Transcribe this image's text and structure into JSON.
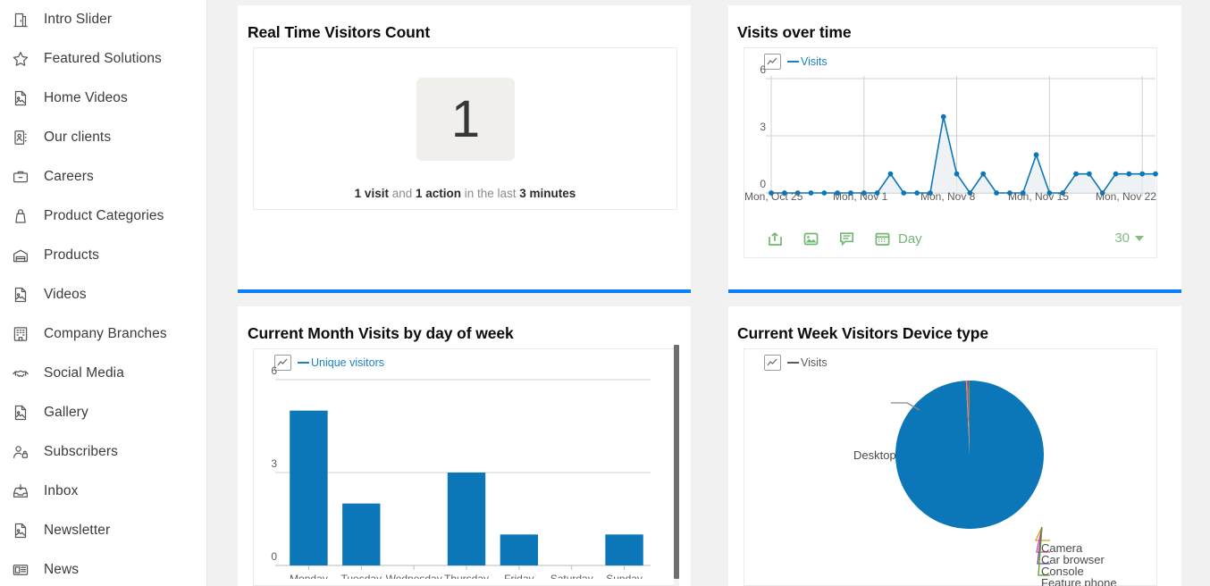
{
  "sidebar": {
    "items": [
      {
        "label": "Intro Slider",
        "icon": "door-icon"
      },
      {
        "label": "Featured Solutions",
        "icon": "star-icon"
      },
      {
        "label": "Home Videos",
        "icon": "document-image-icon"
      },
      {
        "label": "Our clients",
        "icon": "contact-card-icon"
      },
      {
        "label": "Careers",
        "icon": "briefcase-icon"
      },
      {
        "label": "Product Categories",
        "icon": "bag-icon"
      },
      {
        "label": "Products",
        "icon": "warehouse-icon"
      },
      {
        "label": "Videos",
        "icon": "document-image-icon"
      },
      {
        "label": "Company Branches",
        "icon": "office-building-icon"
      },
      {
        "label": "Social Media",
        "icon": "handshake-icon"
      },
      {
        "label": "Gallery",
        "icon": "document-image-icon"
      },
      {
        "label": "Subscribers",
        "icon": "user-lock-icon"
      },
      {
        "label": "Inbox",
        "icon": "inbox-icon"
      },
      {
        "label": "Newsletter",
        "icon": "document-image-icon"
      },
      {
        "label": "News",
        "icon": "newspaper-icon"
      }
    ]
  },
  "cards": {
    "realtime": {
      "title": "Real Time Visitors Count",
      "count": "1",
      "caption": {
        "visits": "1 visit",
        "and": " and ",
        "actions": "1 action",
        "inlast": " in the last ",
        "period": "3 minutes"
      }
    },
    "visits_over_time": {
      "title": "Visits over time",
      "toolbar": {
        "export_icon": "export-icon",
        "image_icon": "image-export-icon",
        "annotation_icon": "annotation-icon",
        "calendar_icon": "calendar-icon",
        "period_label": "Day",
        "rows_label": "30"
      }
    },
    "visits_by_day": {
      "title": "Current Month Visits by day of week"
    },
    "device_type": {
      "title": "Current Week Visitors Device type"
    }
  },
  "colors": {
    "accent_blue": "#0a7ff5",
    "series_blue": "#0b76b8",
    "legend_blue": "#1b7fc4",
    "toolbar_green": "#72b772",
    "page_bg": "#f1f1f1",
    "badge_bg": "#f0efec"
  },
  "chart_data": [
    {
      "id": "visits-over-time",
      "type": "line",
      "title": "Visits over time",
      "legend": [
        "Visits"
      ],
      "legend_position": "top-left",
      "ylabel": "",
      "xlabel": "",
      "ylim": [
        0,
        6
      ],
      "yticks": [
        0,
        3,
        6
      ],
      "grid": true,
      "xtick_labels": [
        "Mon, Oct 25",
        "Mon, Nov 1",
        "Mon, Nov 8",
        "Mon, Nov 15",
        "Mon, Nov 22"
      ],
      "x": [
        "Oct 25",
        "Oct 26",
        "Oct 27",
        "Oct 28",
        "Oct 29",
        "Oct 30",
        "Oct 31",
        "Nov 1",
        "Nov 2",
        "Nov 3",
        "Nov 4",
        "Nov 5",
        "Nov 6",
        "Nov 7",
        "Nov 8",
        "Nov 9",
        "Nov 10",
        "Nov 11",
        "Nov 12",
        "Nov 13",
        "Nov 14",
        "Nov 15",
        "Nov 16",
        "Nov 17",
        "Nov 18",
        "Nov 19",
        "Nov 20",
        "Nov 21",
        "Nov 22",
        "Nov 23"
      ],
      "series": [
        {
          "name": "Visits",
          "values": [
            0,
            0,
            0,
            0,
            0,
            0,
            0,
            0,
            0,
            1,
            0,
            0,
            0,
            4,
            1,
            0,
            1,
            0,
            0,
            0,
            2,
            0,
            0,
            1,
            1,
            0,
            1,
            1,
            1,
            1
          ]
        }
      ]
    },
    {
      "id": "visits-by-day-of-week",
      "type": "bar",
      "title": "Current Month Visits by day of week",
      "legend": [
        "Unique visitors"
      ],
      "legend_position": "top-left",
      "categories": [
        "Monday",
        "Tuesday",
        "Wednesday",
        "Thursday",
        "Friday",
        "Saturday",
        "Sunday"
      ],
      "values": [
        5,
        2,
        0,
        3,
        1,
        0,
        1
      ],
      "ylim": [
        0,
        6
      ],
      "yticks": [
        0,
        3,
        6
      ],
      "grid": true,
      "xlabel": "",
      "ylabel": ""
    },
    {
      "id": "device-type",
      "type": "pie",
      "title": "Current Week Visitors Device type",
      "legend": [
        "Visits"
      ],
      "legend_position": "top-left",
      "labels": [
        "Desktop",
        "Camera",
        "Car browser",
        "Console",
        "Feature phone"
      ],
      "values": [
        99.2,
        0.2,
        0.2,
        0.2,
        0.2
      ],
      "slice_colors": [
        "#0b76b8",
        "#e8971e",
        "#d1459b",
        "#7a3fa8",
        "#5aa02c"
      ]
    }
  ]
}
